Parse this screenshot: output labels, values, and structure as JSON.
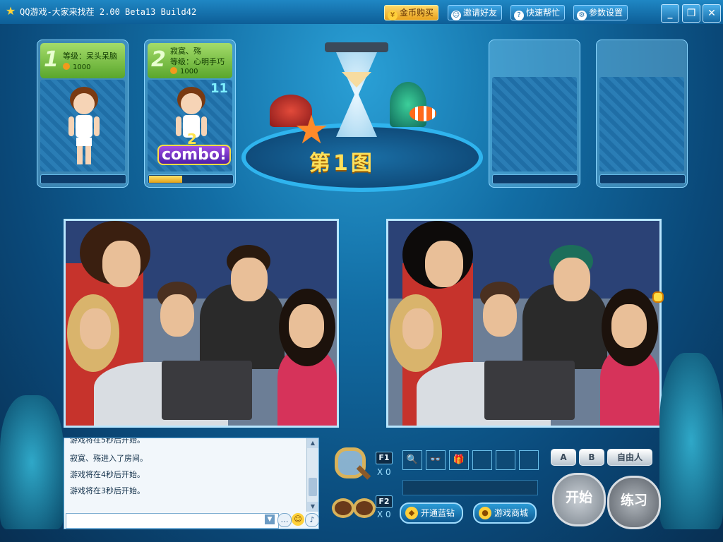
{
  "window": {
    "title": "QQ游戏-大家来找茬 2.00 Beta13 Build42",
    "buttons": {
      "coin_shop": "金币购买",
      "invite": "邀请好友",
      "help": "快速帮忙",
      "settings": "参数设置"
    },
    "controls": {
      "minimize": "_",
      "restore": "❐",
      "close": "✕"
    }
  },
  "players": [
    {
      "seat": "1",
      "name": "",
      "level_text": "等级：呆头呆脑",
      "coins": "1000"
    },
    {
      "seat": "2",
      "name": "寂寞、殇",
      "level_text": "等级：心明手巧",
      "coins": "1000",
      "combo_count": "11",
      "combo_number": "2",
      "combo_label": "combo!",
      "combo_fill": 0.4
    }
  ],
  "round": {
    "label": "第1图"
  },
  "chat": {
    "messages": [
      "游戏将在5秒后开始。",
      "寂寞、殇进入了房间。",
      "游戏将在4秒后开始。",
      "游戏将在3秒后开始。"
    ],
    "input_value": ""
  },
  "tools": {
    "f1_key": "F1",
    "f1_count": "X 0",
    "f2_key": "F2",
    "f2_count": "X 0"
  },
  "bottom": {
    "open_blue_diamond": "开通蓝钻",
    "game_mall": "游戏商城",
    "btn_a": "A",
    "btn_b": "B",
    "btn_free": "自由人",
    "start": "开始",
    "practice": "练习"
  },
  "colors": {
    "accent": "#2fb4ee",
    "gold": "#ffe05a",
    "panel_green": "#5aa62c"
  }
}
